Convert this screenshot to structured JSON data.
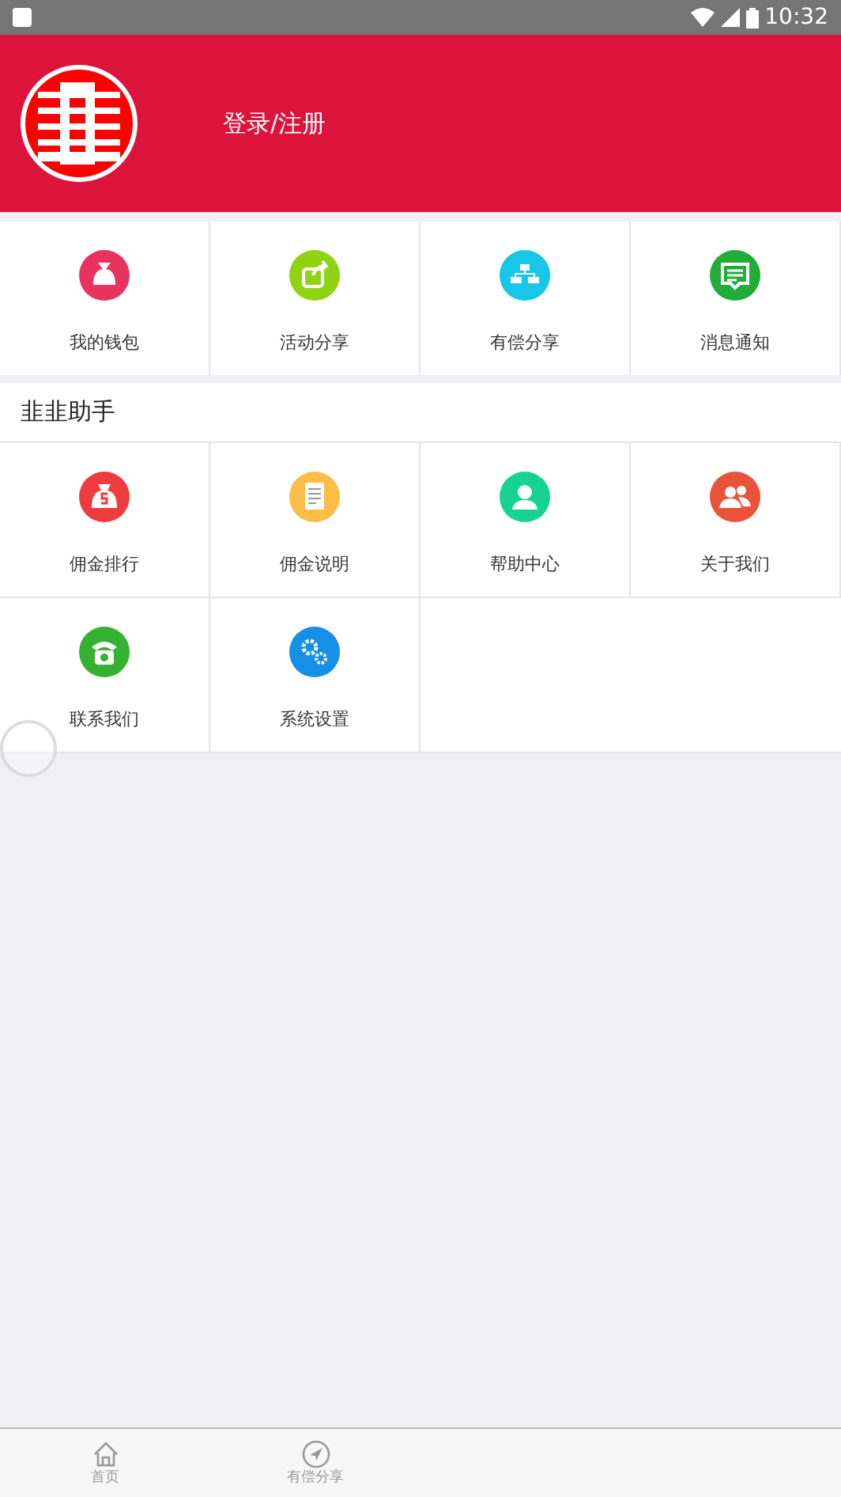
{
  "status_bar": {
    "time": "10:32"
  },
  "header": {
    "login": "登录/注册"
  },
  "quick_menu": [
    {
      "label": "我的钱包",
      "color": "#e8335e"
    },
    {
      "label": "活动分享",
      "color": "#8fd312"
    },
    {
      "label": "有偿分享",
      "color": "#18c6ea"
    },
    {
      "label": "消息通知",
      "color": "#22ac38"
    }
  ],
  "section": {
    "title": "韭韭助手",
    "items": [
      {
        "label": "佣金排行",
        "color": "#ee3b3e"
      },
      {
        "label": "佣金说明",
        "color": "#fbbd45"
      },
      {
        "label": "帮助中心",
        "color": "#16d394"
      },
      {
        "label": "关于我们",
        "color": "#e8533a"
      },
      {
        "label": "联系我们",
        "color": "#35b131"
      },
      {
        "label": "系统设置",
        "color": "#168fe6"
      }
    ]
  },
  "bottom_nav": [
    {
      "label": "首页"
    },
    {
      "label": "有偿分享"
    }
  ]
}
